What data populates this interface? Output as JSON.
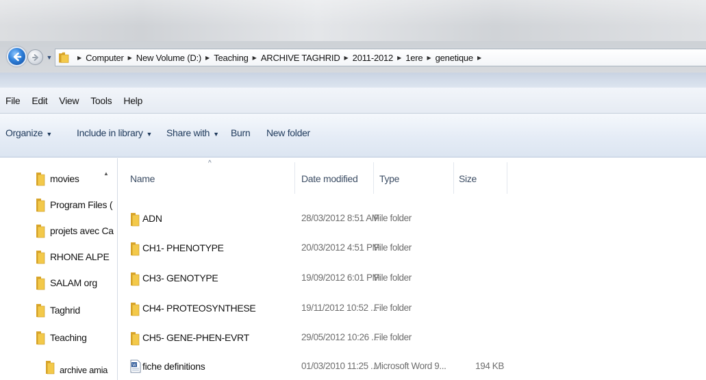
{
  "address": {
    "crumbs": [
      "Computer",
      "New Volume (D:)",
      "Teaching",
      "ARCHIVE TAGHRID",
      "2011-2012",
      "1ere",
      "genetique"
    ]
  },
  "menu": [
    "File",
    "Edit",
    "View",
    "Tools",
    "Help"
  ],
  "toolbar": {
    "organize": "Organize",
    "include_in_library": "Include in library",
    "share_with": "Share with",
    "burn": "Burn",
    "new_folder": "New folder"
  },
  "nav": {
    "items": [
      "movies",
      "Program Files (",
      "projets avec Ca",
      "RHONE ALPE",
      "SALAM org",
      "Taghrid",
      "Teaching",
      "archive amia"
    ]
  },
  "columns": {
    "name": "Name",
    "date_modified": "Date modified",
    "type": "Type",
    "size": "Size"
  },
  "files": [
    {
      "name": "ADN",
      "date": "28/03/2012 8:51 AM",
      "type": "File folder",
      "size": "",
      "icon": "folder-icon"
    },
    {
      "name": "CH1- PHENOTYPE",
      "date": "20/03/2012 4:51 PM",
      "type": "File folder",
      "size": "",
      "icon": "folder-icon"
    },
    {
      "name": "CH3- GENOTYPE",
      "date": "19/09/2012 6:01 PM",
      "type": "File folder",
      "size": "",
      "icon": "folder-icon"
    },
    {
      "name": "CH4- PROTEOSYNTHESE",
      "date": "19/11/2012 10:52 ...",
      "type": "File folder",
      "size": "",
      "icon": "folder-icon"
    },
    {
      "name": "CH5- GENE-PHEN-EVRT",
      "date": "29/05/2012 10:26 ...",
      "type": "File folder",
      "size": "",
      "icon": "folder-icon"
    },
    {
      "name": "fiche definitions",
      "date": "01/03/2010 11:25 ...",
      "type": "Microsoft Word 9...",
      "size": "194 KB",
      "icon": "word-document-icon"
    }
  ],
  "colors": {
    "accent": "#2e7fd9",
    "toolbar_text": "#1e395b",
    "folder_yellow": "#f3c94a",
    "metadata_text": "#6d6d6d"
  }
}
